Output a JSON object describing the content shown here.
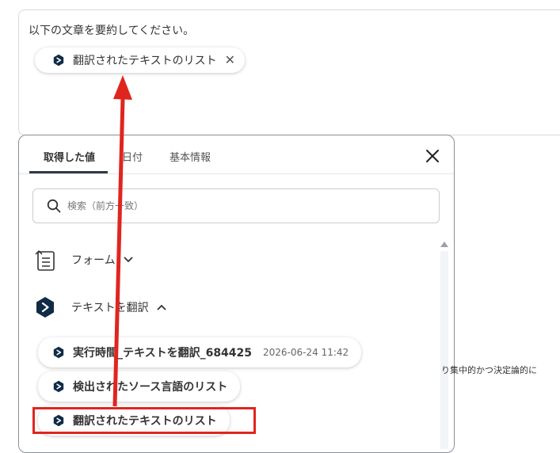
{
  "prompt": {
    "text": "以下の文章を要約してください。",
    "chip_label": "翻訳されたテキストのリスト"
  },
  "tabs": [
    {
      "label": "取得した値"
    },
    {
      "label": "日付"
    },
    {
      "label": "基本情報"
    }
  ],
  "search": {
    "placeholder": "検索（前方一致）"
  },
  "sections": [
    {
      "label": "フォーム",
      "icon": "form-icon",
      "chevron": "down"
    },
    {
      "label": "テキストを翻訳",
      "icon": "deepl-icon",
      "chevron": "up"
    }
  ],
  "outputs": [
    {
      "label": "実行時間_テキストを翻訳_684425",
      "meta": "2026-06-24 11:42"
    },
    {
      "label": "検出されたソース言語のリスト"
    },
    {
      "label": "翻訳されたテキストのリスト"
    }
  ],
  "side_text": "り集中的かつ決定論的に",
  "colors": {
    "accent": "#2f3a4a",
    "annotation": "#e0251f",
    "brand_icon": "#0f2b46"
  }
}
